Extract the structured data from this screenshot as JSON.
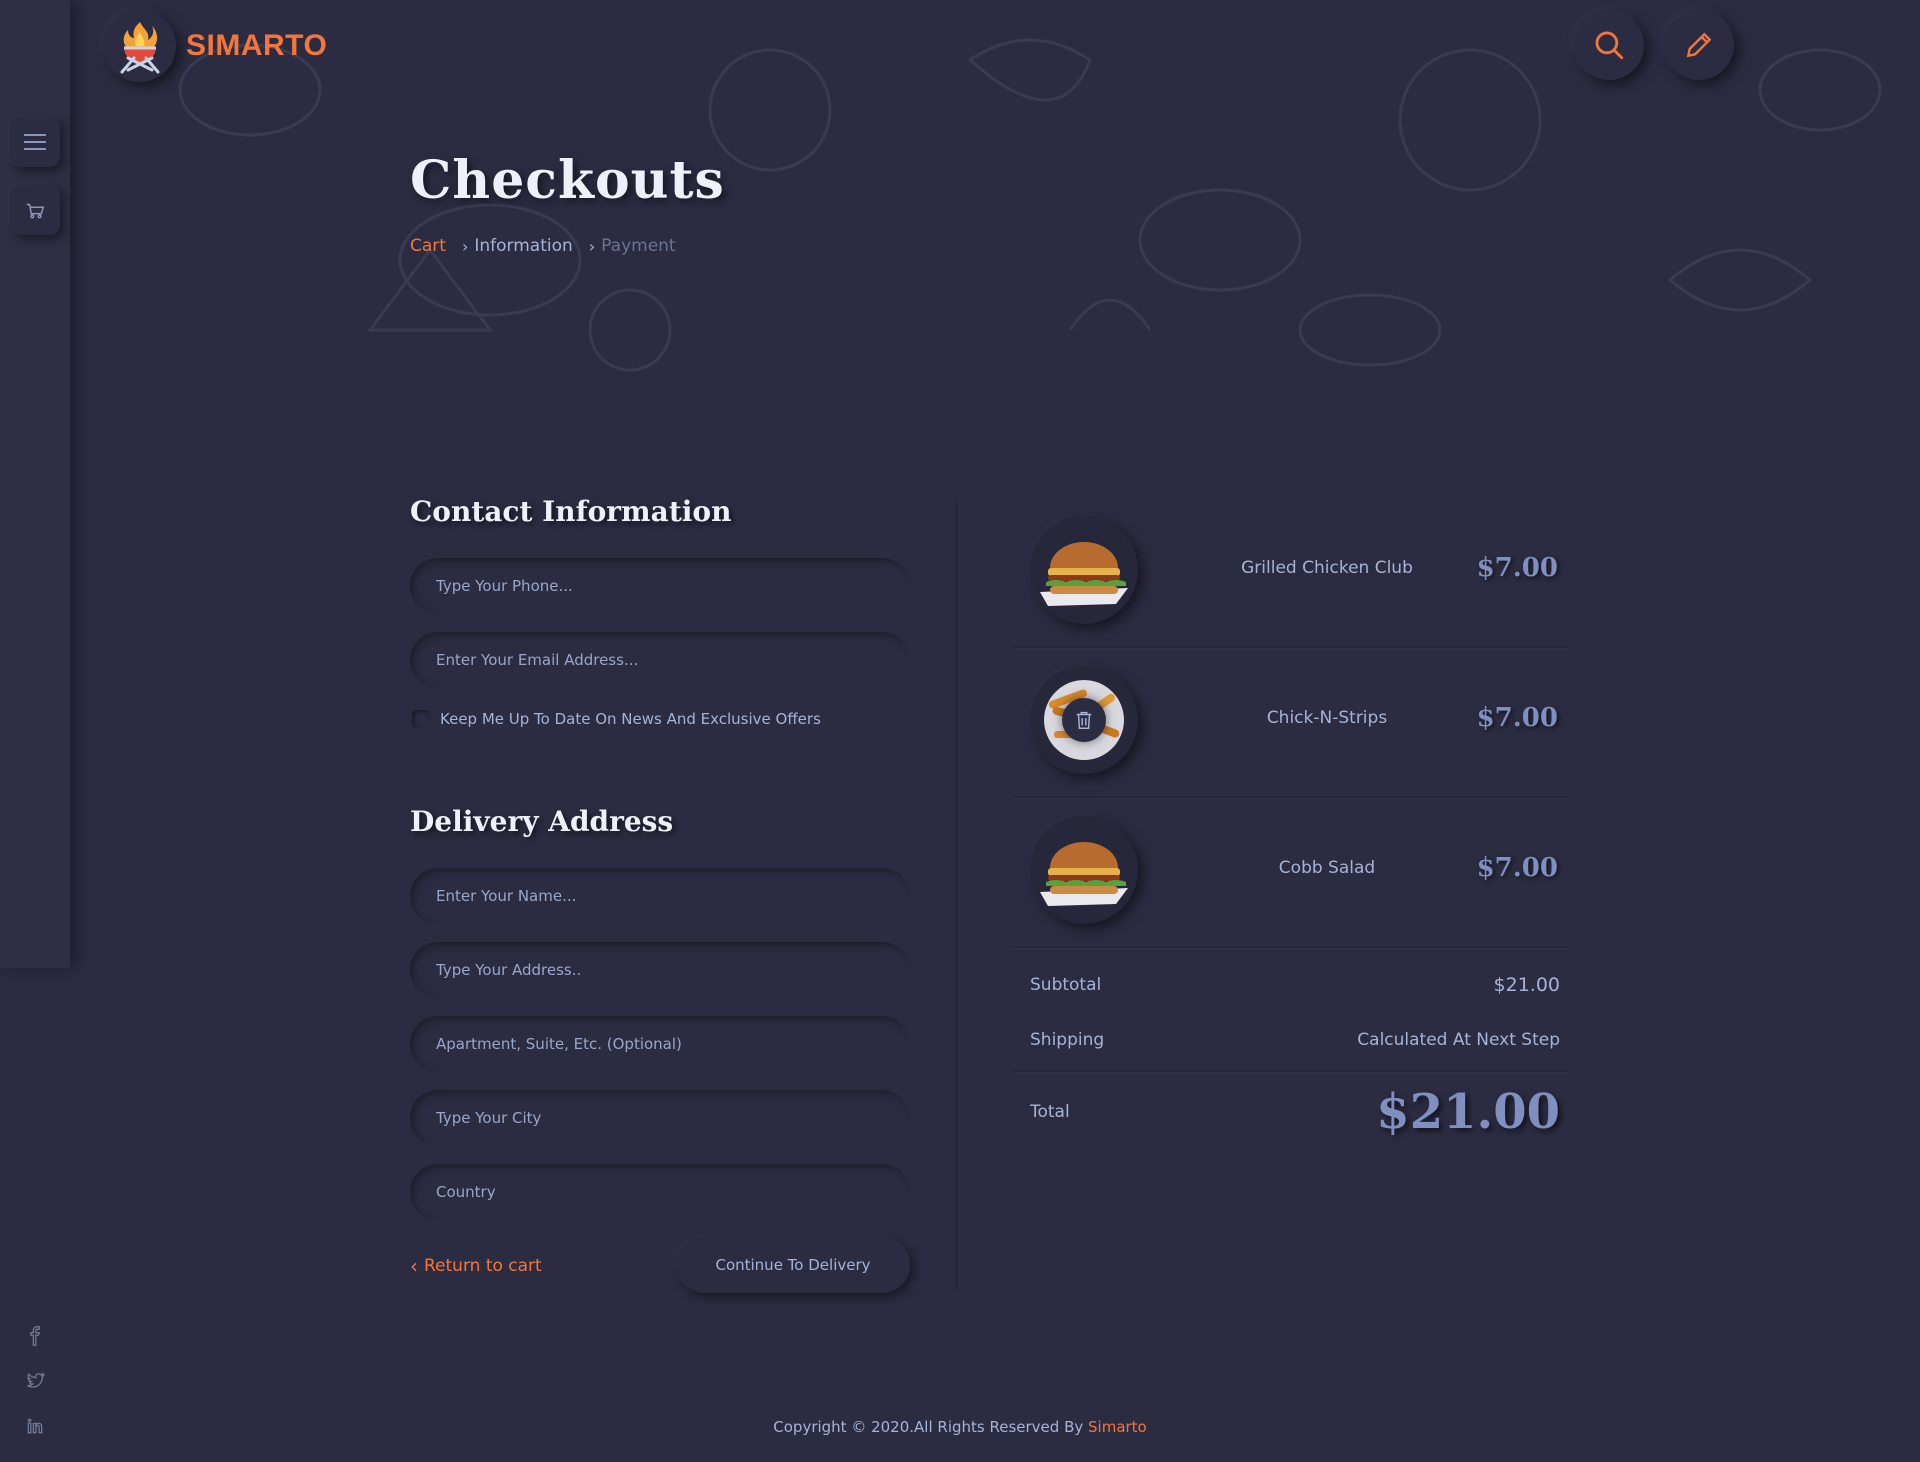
{
  "brand": {
    "name": "SIMARTO",
    "accent": "#f3763a"
  },
  "header": {
    "search_icon": "search-icon",
    "edit_icon": "pencil-icon"
  },
  "rail": {
    "menu_icon": "hamburger-icon",
    "cart_icon": "cart-icon"
  },
  "social": [
    "facebook-icon",
    "twitter-icon",
    "linkedin-icon"
  ],
  "page": {
    "title": "Checkouts",
    "breadcrumb": {
      "cart": "Cart",
      "information": "Information",
      "payment": "Payment"
    }
  },
  "contact": {
    "title": "Contact Information",
    "phone_placeholder": "Type Your Phone...",
    "email_placeholder": "Enter Your Email Address...",
    "newsletter_label": "Keep Me Up To Date On News And Exclusive Offers"
  },
  "delivery": {
    "title": "Delivery Address",
    "name_placeholder": "Enter Your Name...",
    "address_placeholder": "Type Your Address..",
    "apartment_placeholder": "Apartment, Suite, Etc. (Optional)",
    "city_placeholder": "Type Your City",
    "country_placeholder": "Country"
  },
  "actions": {
    "return": "Return to cart",
    "continue": "Continue To Delivery"
  },
  "order": {
    "items": [
      {
        "name": "Grilled Chicken Club",
        "price": "$7.00"
      },
      {
        "name": "Chick-N-Strips",
        "price": "$7.00"
      },
      {
        "name": "Cobb Salad",
        "price": "$7.00"
      }
    ],
    "subtotal_label": "Subtotal",
    "subtotal": "$21.00",
    "shipping_label": "Shipping",
    "shipping": "Calculated At Next Step",
    "total_label": "Total",
    "total": "$21.00"
  },
  "footer": {
    "text": "Copyright © 2020.All Rights Reserved By ",
    "brand": "Simarto"
  }
}
